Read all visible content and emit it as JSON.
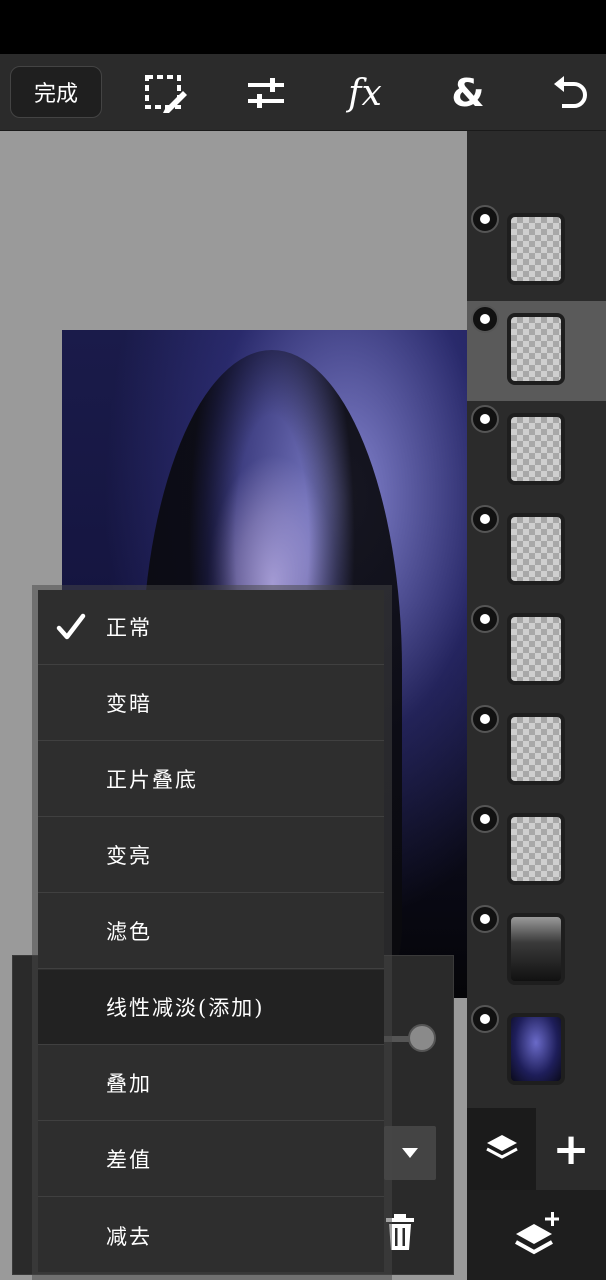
{
  "toolbar": {
    "done_label": "完成",
    "tools": [
      {
        "name": "selection-edit-icon"
      },
      {
        "name": "adjust-sliders-icon"
      },
      {
        "name": "effects-fx-icon",
        "label": "fx"
      },
      {
        "name": "ampersand-icon",
        "label": "&"
      },
      {
        "name": "undo-icon"
      }
    ]
  },
  "blend_menu": {
    "selected": "正常",
    "items": [
      {
        "label": "正常",
        "checked": true
      },
      {
        "label": "变暗"
      },
      {
        "label": "正片叠底"
      },
      {
        "label": "变亮"
      },
      {
        "label": "滤色"
      },
      {
        "label": "线性减淡(添加)",
        "highlighted": true
      },
      {
        "label": "叠加"
      },
      {
        "label": "差值"
      },
      {
        "label": "减去"
      }
    ]
  },
  "layers": {
    "count": 9,
    "selected_index": 1,
    "items": [
      {
        "type": "transparent"
      },
      {
        "type": "transparent"
      },
      {
        "type": "transparent"
      },
      {
        "type": "transparent"
      },
      {
        "type": "transparent"
      },
      {
        "type": "transparent"
      },
      {
        "type": "transparent"
      },
      {
        "type": "photo-portrait"
      },
      {
        "type": "photo-blue"
      }
    ]
  },
  "colors": {
    "toolbar_bg": "#2b2b2b",
    "canvas_bg": "#9a9a9a",
    "menu_bg": "#2e2e2e",
    "selected_layer_bg": "#5a5a5a"
  }
}
